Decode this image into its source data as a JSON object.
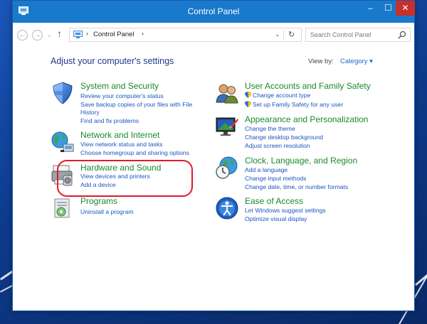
{
  "window": {
    "title": "Control Panel",
    "minimize": "–",
    "maximize": "☐",
    "close": "✕"
  },
  "nav": {
    "back": "←",
    "forward": "→",
    "recent": "⌄",
    "up": "↑",
    "chevron": "›",
    "address_text": "Control Panel",
    "address_dropdown": "⌄",
    "refresh": "↻",
    "search_placeholder": "Search Control Panel"
  },
  "main": {
    "heading": "Adjust your computer's settings",
    "view_by_label": "View by:",
    "view_by_value": "Category ▾"
  },
  "categories_left": [
    {
      "title": "System and Security",
      "icon": "shield-icon",
      "links": [
        "Review your computer's status",
        "Save backup copies of your files with File",
        "History",
        "Find and fix problems"
      ]
    },
    {
      "title": "Network and Internet",
      "icon": "network-icon",
      "links": [
        "View network status and tasks",
        "Choose homegroup and sharing options"
      ]
    },
    {
      "title": "Hardware and Sound",
      "icon": "printer-icon",
      "links": [
        "View devices and printers",
        "Add a device"
      ]
    },
    {
      "title": "Programs",
      "icon": "programs-icon",
      "links": [
        "Uninstall a program"
      ]
    }
  ],
  "categories_right": [
    {
      "title": "User Accounts and Family Safety",
      "icon": "users-icon",
      "links": [
        "Change account type",
        "Set up Family Safety for any user"
      ]
    },
    {
      "title": "Appearance and Personalization",
      "icon": "monitor-icon",
      "links": [
        "Change the theme",
        "Change desktop background",
        "Adjust screen resolution"
      ]
    },
    {
      "title": "Clock, Language, and Region",
      "icon": "globe-clock-icon",
      "links": [
        "Add a language",
        "Change input methods",
        "Change date, time, or number formats"
      ]
    },
    {
      "title": "Ease of Access",
      "icon": "ease-of-access-icon",
      "links": [
        "Let Windows suggest settings",
        "Optimize visual display"
      ]
    }
  ],
  "colors": {
    "titlebar": "#1979ca",
    "category_title": "#1a8a2a",
    "link": "#1a55c2",
    "highlight_ring": "#e0192e",
    "close_button": "#c7302b"
  }
}
